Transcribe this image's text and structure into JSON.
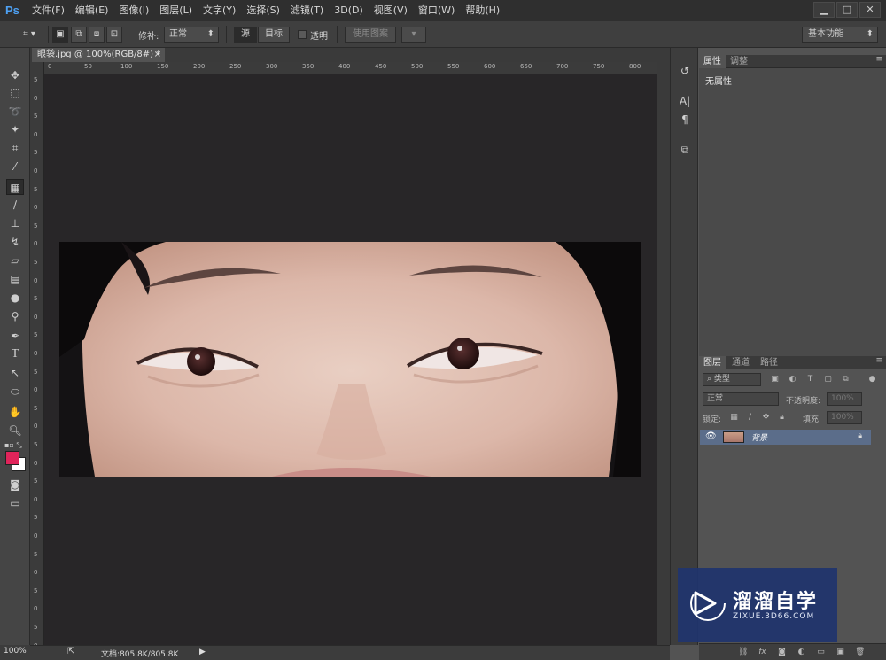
{
  "app": {
    "logo": "Ps"
  },
  "menu": [
    "文件(F)",
    "编辑(E)",
    "图像(I)",
    "图层(L)",
    "文字(Y)",
    "选择(S)",
    "滤镜(T)",
    "3D(D)",
    "视图(V)",
    "窗口(W)",
    "帮助(H)"
  ],
  "window_controls": {
    "minimize": "▁",
    "maximize": "□",
    "close": "✕"
  },
  "options": {
    "patch_label": "修补:",
    "patch_mode": "正常",
    "source": "源",
    "target": "目标",
    "transparent": "透明",
    "use_pattern": "使用图案",
    "workspace": "基本功能"
  },
  "document": {
    "tab_title": "眼袋.jpg @ 100%(RGB/8#) *",
    "zoom": "100%",
    "doc_size": "文档:805.8K/805.8K"
  },
  "ruler_h": [
    "0",
    "50",
    "100",
    "150",
    "200",
    "250",
    "300",
    "350",
    "400",
    "450",
    "500",
    "550",
    "600",
    "650",
    "700",
    "750",
    "800"
  ],
  "ruler_v": [
    "5",
    "0",
    "5",
    "0",
    "5",
    "0",
    "5",
    "0",
    "5",
    "0",
    "5",
    "0",
    "5",
    "0",
    "5",
    "0",
    "5",
    "0",
    "5",
    "0",
    "5",
    "0",
    "5",
    "0",
    "5",
    "0",
    "5",
    "0",
    "5",
    "0",
    "5",
    "0"
  ],
  "properties_panel": {
    "tabs": [
      "属性",
      "调整"
    ],
    "empty_text": "无属性"
  },
  "layers_panel": {
    "tabs": [
      "图层",
      "通道",
      "路径"
    ],
    "filter_kind": "类型",
    "blend_mode": "正常",
    "opacity_label": "不透明度:",
    "opacity_value": "100%",
    "lock_label": "锁定:",
    "fill_label": "填充:",
    "fill_value": "100%",
    "layers": [
      {
        "name": "背景",
        "visible": true,
        "locked": true
      }
    ]
  },
  "watermark": {
    "title": "溜溜自学",
    "subtitle": "ZIXUE.3D66.COM"
  },
  "colors": {
    "foreground": "#e0245a",
    "background": "#ffffff",
    "selected_layer": "#5b6d8a"
  }
}
